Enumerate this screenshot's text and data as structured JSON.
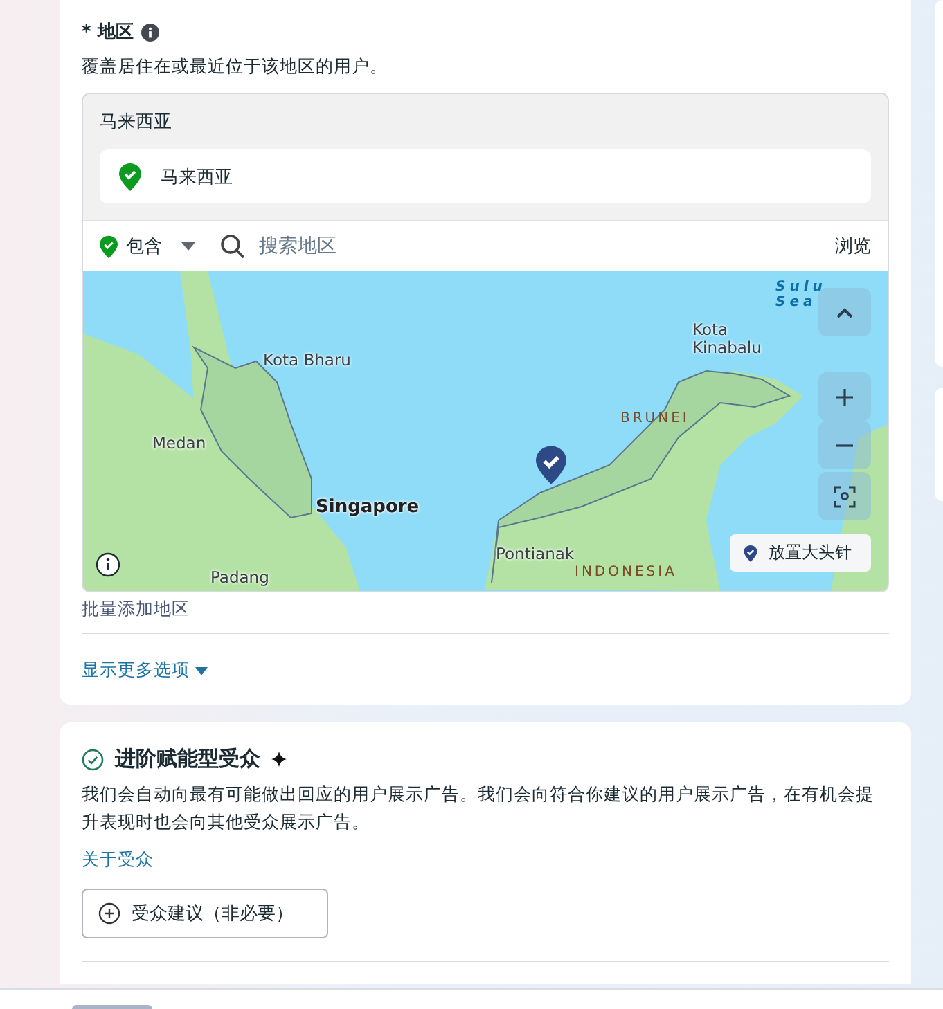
{
  "region": {
    "required_mark": "*",
    "title": "地区",
    "description": "覆盖居住在或最近位于该地区的用户。",
    "group_label": "马来西亚",
    "locations": [
      {
        "name": "马来西亚",
        "kind": "included"
      }
    ],
    "filter": {
      "mode": "包含",
      "search_placeholder": "搜索地区",
      "browse": "浏览"
    },
    "map": {
      "labels": [
        {
          "text": "Kota Bharu",
          "kind": "city"
        },
        {
          "text": "Medan",
          "kind": "city"
        },
        {
          "text": "Singapore",
          "kind": "capital"
        },
        {
          "text": "Padang",
          "kind": "city"
        },
        {
          "text": "Pontianak",
          "kind": "city"
        },
        {
          "text": "Kota Kinabalu",
          "kind": "city"
        },
        {
          "text": "BRUNEI",
          "kind": "country"
        },
        {
          "text": "INDONESIA",
          "kind": "country"
        },
        {
          "text": "Sulu Sea",
          "kind": "sea"
        }
      ],
      "pin_button": "放置大头针"
    },
    "bulk_add": "批量添加地区",
    "more_options": "显示更多选项"
  },
  "audience": {
    "title": "进阶赋能型受众",
    "description": "我们会自动向最有可能做出回应的用户展示广告。我们会向符合你建议的用户展示广告，在有机会提升表现时也会向其他受众展示广告。",
    "link": "关于受众",
    "suggest_button": "受众建议（非必要）"
  }
}
